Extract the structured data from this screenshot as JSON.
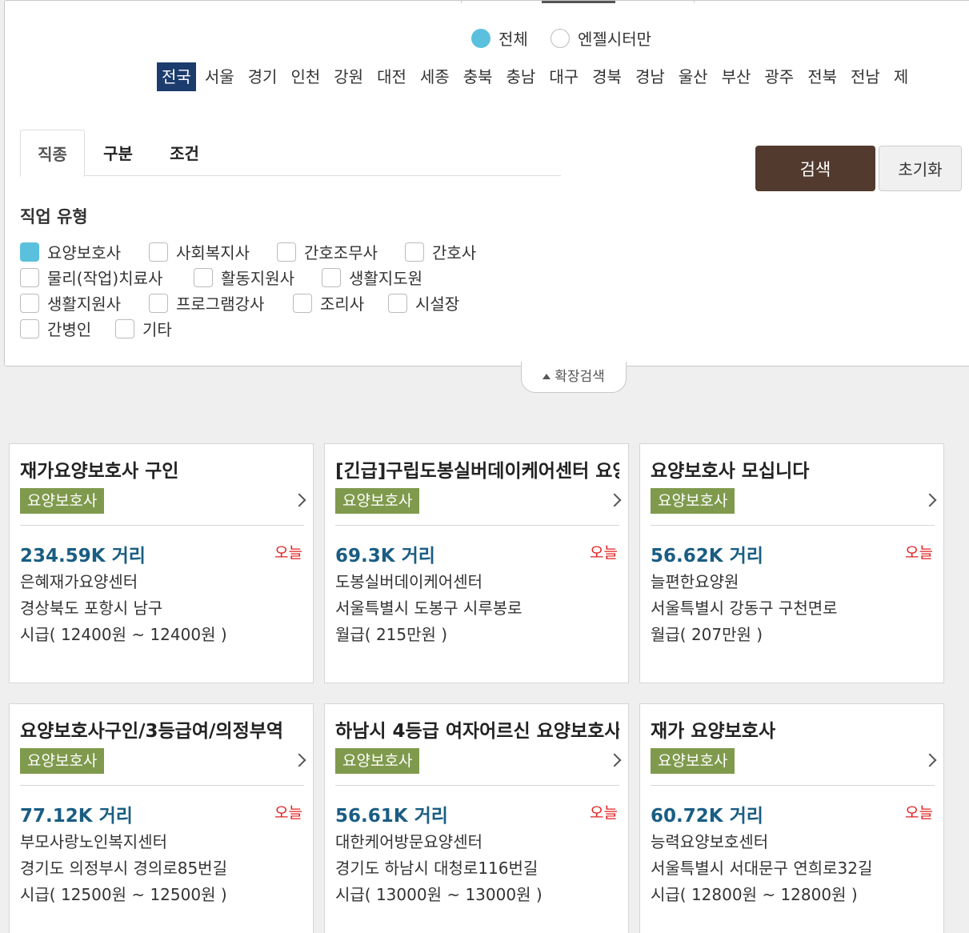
{
  "scope": {
    "all_label": "전체",
    "angel_label": "엔젤시터만",
    "selected": "전체"
  },
  "regions": [
    "전국",
    "서울",
    "경기",
    "인천",
    "강원",
    "대전",
    "세종",
    "충북",
    "충남",
    "대구",
    "경북",
    "경남",
    "울산",
    "부산",
    "광주",
    "전북",
    "전남",
    "제"
  ],
  "active_region": "전국",
  "tabs": [
    "직종",
    "구분",
    "조건"
  ],
  "active_tab": "직종",
  "buttons": {
    "search": "검색",
    "reset": "초기화"
  },
  "job_types": {
    "title": "직업 유형",
    "items": [
      {
        "label": "요양보호사",
        "checked": true
      },
      {
        "label": "사회복지사",
        "checked": false
      },
      {
        "label": "간호조무사",
        "checked": false
      },
      {
        "label": "간호사",
        "checked": false
      },
      {
        "label": "물리(작업)치료사",
        "checked": false
      },
      {
        "label": "활동지원사",
        "checked": false
      },
      {
        "label": "생활지도원",
        "checked": false
      },
      {
        "label": "생활지원사",
        "checked": false
      },
      {
        "label": "프로그램강사",
        "checked": false
      },
      {
        "label": "조리사",
        "checked": false
      },
      {
        "label": "시설장",
        "checked": false
      },
      {
        "label": "간병인",
        "checked": false
      },
      {
        "label": "기타",
        "checked": false
      }
    ]
  },
  "expand_label": "확장검색",
  "colors": {
    "navy": "#1d3c6e",
    "brown": "#523a2f",
    "badge_green": "#7f9a4d",
    "distance_blue": "#1a5d83",
    "today_red": "#e02020",
    "check_blue": "#5bc0de"
  },
  "cards": [
    {
      "title": "재가요양보호사 구인",
      "badge": "요양보호사",
      "distance": "234.59K 거리",
      "date": "오늘",
      "center": "은혜재가요양센터",
      "address": "경상북도 포항시 남구",
      "wage": "시급( 12400원 ~ 12400원 )"
    },
    {
      "title": "[긴급]구립도봉실버데이케어센터 요양보호사",
      "badge": "요양보호사",
      "distance": "69.3K 거리",
      "date": "오늘",
      "center": "도봉실버데이케어센터",
      "address": "서울특별시 도봉구 시루봉로",
      "wage": "월급( 215만원 )"
    },
    {
      "title": "요양보호사 모십니다",
      "badge": "요양보호사",
      "distance": "56.62K 거리",
      "date": "오늘",
      "center": "늘편한요양원",
      "address": "서울특별시 강동구 구천면로",
      "wage": "월급( 207만원 )"
    },
    {
      "title": "요양보호사구인/3등급여/의정부역",
      "badge": "요양보호사",
      "distance": "77.12K 거리",
      "date": "오늘",
      "center": "부모사랑노인복지센터",
      "address": "경기도 의정부시 경의로85번길",
      "wage": "시급( 12500원 ~ 12500원 )"
    },
    {
      "title": "하남시 4등급 여자어르신 요양보호사",
      "badge": "요양보호사",
      "distance": "56.61K 거리",
      "date": "오늘",
      "center": "대한케어방문요양센터",
      "address": "경기도 하남시 대청로116번길",
      "wage": "시급( 13000원 ~ 13000원 )"
    },
    {
      "title": "재가 요양보호사",
      "badge": "요양보호사",
      "distance": "60.72K 거리",
      "date": "오늘",
      "center": "능력요양보호센터",
      "address": "서울특별시 서대문구 연희로32길",
      "wage": "시급( 12800원 ~ 12800원 )"
    }
  ]
}
